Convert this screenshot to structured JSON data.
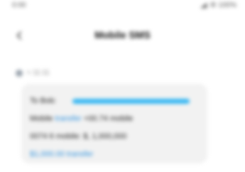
{
  "status_bar": {
    "time": "0:00",
    "right": "⚙ 100%"
  },
  "header": {
    "title": "Mobile SMS",
    "back_icon": "chevron-left-icon"
  },
  "conversation": {
    "timestamp": "≈ 11:11",
    "message": {
      "line1_prefix": "To Bob:",
      "line2_a": "Mobile",
      "line2_link": "transfer",
      "line2_b": "+00.74 mobile",
      "line3": "0074 6 mobile: $, 1,000,000",
      "line4_a": "$1,000.00",
      "line4_link": "transfer"
    }
  },
  "colors": {
    "bubble_bg": "#f2f2f2",
    "link": "#35b7f3"
  }
}
